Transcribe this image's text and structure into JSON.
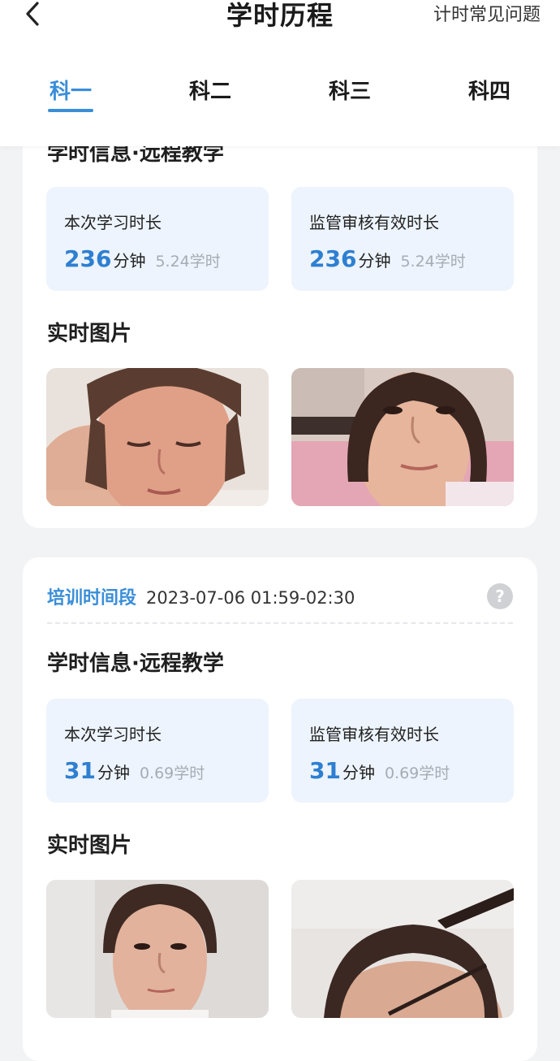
{
  "header": {
    "title": "学时历程",
    "faq_label": "计时常见问题"
  },
  "tabs": [
    {
      "label": "科一",
      "active": true
    },
    {
      "label": "科二",
      "active": false
    },
    {
      "label": "科三",
      "active": false
    },
    {
      "label": "科四",
      "active": false
    }
  ],
  "records": [
    {
      "section_title": "学时信息·远程教学",
      "study_duration": {
        "label": "本次学习时长",
        "minutes": "236",
        "unit": "分钟",
        "hours": "5.24学时"
      },
      "verified_duration": {
        "label": "监管审核有效时长",
        "minutes": "236",
        "unit": "分钟",
        "hours": "5.24学时"
      },
      "photos_title": "实时图片"
    },
    {
      "period_label": "培训时间段",
      "period_time": "2023-07-06 01:59-02:30",
      "section_title": "学时信息·远程教学",
      "study_duration": {
        "label": "本次学习时长",
        "minutes": "31",
        "unit": "分钟",
        "hours": "0.69学时"
      },
      "verified_duration": {
        "label": "监管审核有效时长",
        "minutes": "31",
        "unit": "分钟",
        "hours": "0.69学时"
      },
      "photos_title": "实时图片"
    }
  ],
  "colors": {
    "accent": "#3a8ed8",
    "stat_box_bg": "#edf4fd",
    "page_bg": "#f2f3f5"
  }
}
